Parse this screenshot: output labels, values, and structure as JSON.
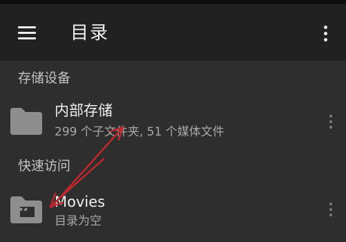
{
  "colors": {
    "appbar_bg": "#212121",
    "content_bg": "#2e2e2e",
    "icon_gray": "#8e8e8e",
    "annotation_red": "#c0282d"
  },
  "toolbar": {
    "menu_icon": "hamburger-menu-icon",
    "title": "目录",
    "overflow_icon": "more-vertical-icon"
  },
  "sections": [
    {
      "header": "存储设备",
      "items": [
        {
          "icon": "folder-icon",
          "title": "内部存储",
          "subtitle": "299 个子文件夹, 51 个媒体文件",
          "overflow_icon": "more-vertical-icon"
        }
      ]
    },
    {
      "header": "快速访问",
      "items": [
        {
          "icon": "movie-folder-icon",
          "title": "Movies",
          "subtitle": "目录为空",
          "overflow_icon": "more-vertical-icon"
        }
      ]
    }
  ]
}
